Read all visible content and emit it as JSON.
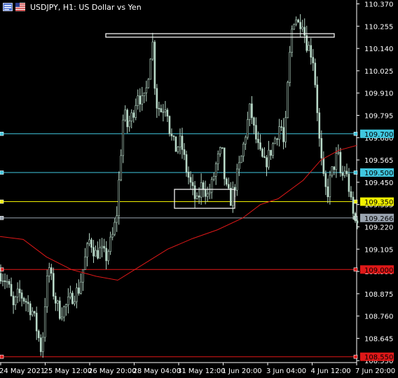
{
  "header": {
    "title": "USDJPY, H1:  US Dollar vs Yen",
    "icons": [
      "chart-window-icon",
      "flag-icon"
    ]
  },
  "colors": {
    "background": "#000000",
    "candles": "#b8d9c8",
    "axis_text": "#ffffff",
    "ma_line": "#e01818",
    "cyan_level": "#40c8e0",
    "yellow_level": "#f0f000",
    "red_level": "#e01818",
    "price_label": "#9aa4b0",
    "boxes": "#f0f0f0"
  },
  "chart_data": {
    "type": "candlestick",
    "symbol": "USDJPY",
    "timeframe": "H1",
    "ylim": [
      108.52,
      110.39
    ],
    "y_ticks": [
      "110.370",
      "110.255",
      "110.140",
      "110.025",
      "109.910",
      "109.795",
      "109.680",
      "109.565",
      "109.450",
      "109.335",
      "109.220",
      "109.105",
      "108.990",
      "108.875",
      "108.760",
      "108.645",
      "108.530"
    ],
    "x_ticks": [
      "24 May 2021",
      "25 May 12:00",
      "26 May 20:00",
      "28 May 04:00",
      "31 May 12:00",
      "1 Jun 20:00",
      "3 Jun 04:00",
      "4 Jun 12:00",
      "7 Jun 20:00"
    ],
    "horizontal_levels": [
      {
        "price": 109.7,
        "label": "109.700",
        "color": "cyan"
      },
      {
        "price": 109.5,
        "label": "109.500",
        "color": "cyan"
      },
      {
        "price": 109.35,
        "label": "109.350",
        "color": "yellow"
      },
      {
        "price": 109.266,
        "label": "109.266",
        "color": "gray",
        "current_price": true
      },
      {
        "price": 109.0,
        "label": "109.000",
        "color": "red"
      },
      {
        "price": 108.55,
        "label": "108.550",
        "color": "red"
      }
    ],
    "rectangles": [
      {
        "name": "resistance-zone",
        "price_high": 110.21,
        "price_low": 110.19,
        "time_start": "27 May",
        "time_end": "4 Jun"
      },
      {
        "name": "support-zone",
        "price_high": 109.41,
        "price_low": 109.32,
        "time_start": "31 May",
        "time_end": "1 Jun"
      }
    ],
    "moving_average_path": [
      [
        0,
        109.17
      ],
      [
        0.065,
        109.155
      ],
      [
        0.13,
        109.065
      ],
      [
        0.2,
        109.0
      ],
      [
        0.27,
        108.965
      ],
      [
        0.33,
        108.945
      ],
      [
        0.4,
        109.025
      ],
      [
        0.47,
        109.105
      ],
      [
        0.54,
        109.16
      ],
      [
        0.61,
        109.205
      ],
      [
        0.68,
        109.265
      ],
      [
        0.73,
        109.335
      ],
      [
        0.78,
        109.365
      ],
      [
        0.85,
        109.46
      ],
      [
        0.9,
        109.565
      ],
      [
        0.95,
        109.615
      ],
      [
        1.0,
        109.64
      ]
    ],
    "close_path": [
      [
        0,
        108.98
      ],
      [
        0.02,
        108.93
      ],
      [
        0.035,
        108.8
      ],
      [
        0.05,
        108.88
      ],
      [
        0.07,
        108.84
      ],
      [
        0.09,
        108.78
      ],
      [
        0.105,
        108.66
      ],
      [
        0.115,
        108.57
      ],
      [
        0.125,
        108.85
      ],
      [
        0.135,
        109.02
      ],
      [
        0.15,
        108.86
      ],
      [
        0.165,
        108.78
      ],
      [
        0.18,
        108.8
      ],
      [
        0.2,
        108.86
      ],
      [
        0.22,
        108.9
      ],
      [
        0.235,
        109.04
      ],
      [
        0.25,
        109.16
      ],
      [
        0.265,
        109.08
      ],
      [
        0.28,
        109.1
      ],
      [
        0.295,
        109.06
      ],
      [
        0.305,
        109.12
      ],
      [
        0.315,
        109.18
      ],
      [
        0.325,
        109.28
      ],
      [
        0.335,
        109.55
      ],
      [
        0.345,
        109.82
      ],
      [
        0.355,
        109.74
      ],
      [
        0.37,
        109.8
      ],
      [
        0.385,
        109.92
      ],
      [
        0.395,
        109.86
      ],
      [
        0.405,
        109.88
      ],
      [
        0.415,
        110.03
      ],
      [
        0.425,
        110.2
      ],
      [
        0.435,
        109.86
      ],
      [
        0.45,
        109.82
      ],
      [
        0.465,
        109.86
      ],
      [
        0.475,
        109.7
      ],
      [
        0.49,
        109.62
      ],
      [
        0.505,
        109.66
      ],
      [
        0.52,
        109.52
      ],
      [
        0.535,
        109.42
      ],
      [
        0.55,
        109.34
      ],
      [
        0.565,
        109.45
      ],
      [
        0.58,
        109.38
      ],
      [
        0.59,
        109.42
      ],
      [
        0.605,
        109.55
      ],
      [
        0.62,
        109.62
      ],
      [
        0.63,
        109.42
      ],
      [
        0.645,
        109.36
      ],
      [
        0.66,
        109.46
      ],
      [
        0.675,
        109.58
      ],
      [
        0.69,
        109.74
      ],
      [
        0.7,
        109.84
      ],
      [
        0.71,
        109.72
      ],
      [
        0.725,
        109.6
      ],
      [
        0.74,
        109.54
      ],
      [
        0.755,
        109.6
      ],
      [
        0.77,
        109.68
      ],
      [
        0.785,
        109.76
      ],
      [
        0.795,
        109.62
      ],
      [
        0.805,
        109.95
      ],
      [
        0.815,
        110.22
      ],
      [
        0.825,
        110.32
      ],
      [
        0.835,
        110.26
      ],
      [
        0.845,
        110.3
      ],
      [
        0.855,
        110.18
      ],
      [
        0.865,
        110.14
      ],
      [
        0.875,
        110.1
      ],
      [
        0.885,
        109.9
      ],
      [
        0.895,
        109.62
      ],
      [
        0.905,
        109.46
      ],
      [
        0.915,
        109.38
      ],
      [
        0.925,
        109.48
      ],
      [
        0.935,
        109.54
      ],
      [
        0.945,
        109.6
      ],
      [
        0.955,
        109.46
      ],
      [
        0.965,
        109.52
      ],
      [
        0.975,
        109.44
      ],
      [
        0.985,
        109.3
      ],
      [
        0.995,
        109.24
      ],
      [
        1.0,
        109.27
      ]
    ]
  }
}
